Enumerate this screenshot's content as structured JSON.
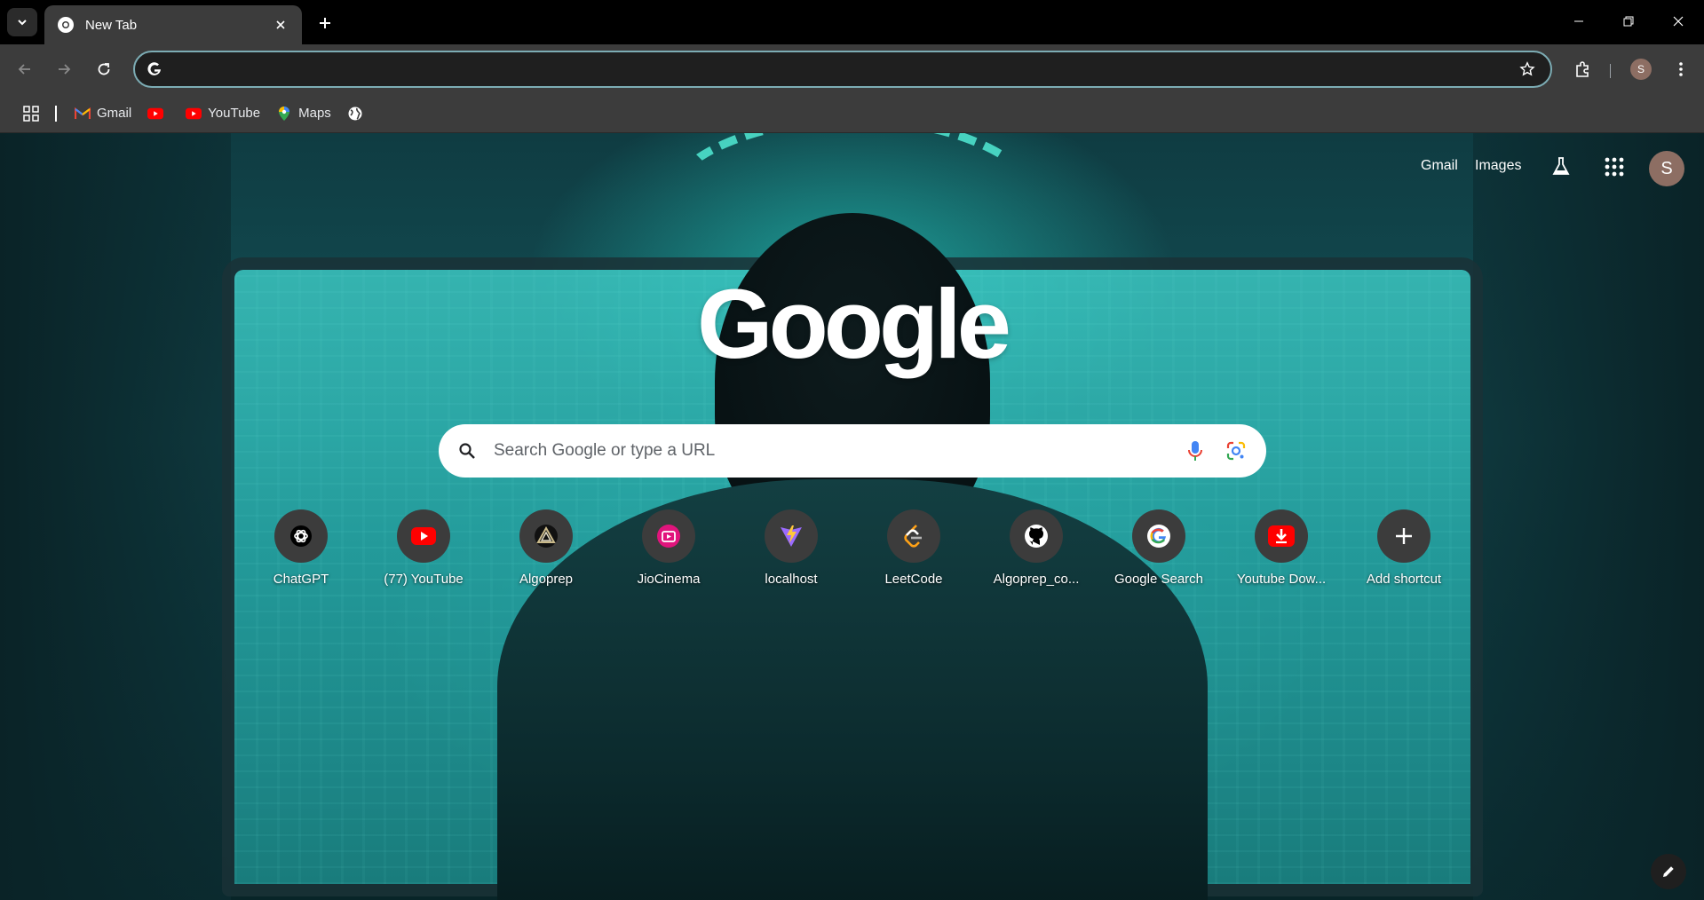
{
  "tab": {
    "title": "New Tab"
  },
  "omnibox": {
    "value": ""
  },
  "bookmarks": [
    {
      "label": "Gmail",
      "icon": "gmail-icon"
    },
    {
      "label": "",
      "icon": "youtube-icon"
    },
    {
      "label": "YouTube",
      "icon": "youtube-icon"
    },
    {
      "label": "Maps",
      "icon": "maps-icon"
    },
    {
      "label": "",
      "icon": "globe-icon"
    }
  ],
  "profile": {
    "initial": "S"
  },
  "ntp": {
    "logo": "Google",
    "links": {
      "gmail": "Gmail",
      "images": "Images"
    },
    "search_placeholder": "Search Google or type a URL",
    "avatar_initial": "S",
    "shortcuts": [
      {
        "label": "ChatGPT",
        "icon": "chatgpt-icon"
      },
      {
        "label": "(77) YouTube",
        "icon": "youtube-icon"
      },
      {
        "label": "Algoprep",
        "icon": "algoprep-icon"
      },
      {
        "label": "JioCinema",
        "icon": "jiocinema-icon"
      },
      {
        "label": "localhost",
        "icon": "vite-icon"
      },
      {
        "label": "LeetCode",
        "icon": "leetcode-icon"
      },
      {
        "label": "Algoprep_co...",
        "icon": "github-icon"
      },
      {
        "label": "Google Search",
        "icon": "google-icon"
      },
      {
        "label": "Youtube Dow...",
        "icon": "download-icon"
      },
      {
        "label": "Add shortcut",
        "icon": "plus-icon"
      }
    ]
  },
  "colors": {
    "accent": "#7cacb4",
    "toolbar": "#3c3c3c",
    "youtube_red": "#ff0000",
    "jiocinema_pink": "#e1147c"
  }
}
